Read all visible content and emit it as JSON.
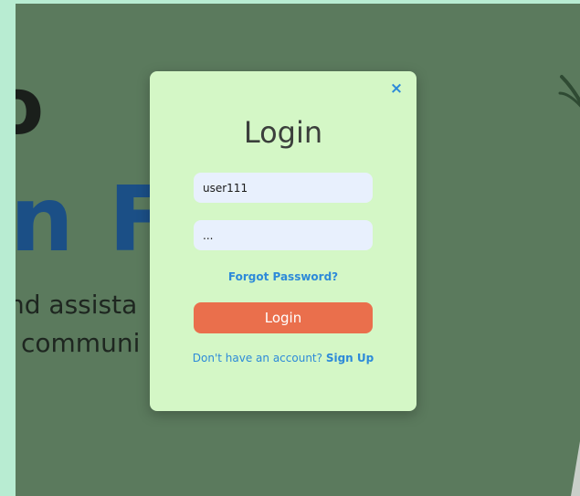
{
  "background": {
    "hero_line_1": "o",
    "hero_line_2": "n Fi",
    "hero_line_3": "nd assista",
    "hero_line_4": "communi"
  },
  "modal": {
    "close_glyph": "×",
    "title": "Login",
    "username_value": "user111",
    "password_value": "...",
    "forgot_password": "Forgot Password?",
    "login_button": "Login",
    "signup_prompt": "Don't have an account?",
    "signup_link": "Sign Up"
  },
  "colors": {
    "page_bg": "#b8ecd2",
    "backdrop": "#5b7a5d",
    "modal_bg": "#d4f7c6",
    "accent_blue": "#2d8ad9",
    "login_button": "#ea6f4c",
    "input_bg": "#e8f0fd"
  },
  "icons": {
    "close": "close-icon"
  }
}
